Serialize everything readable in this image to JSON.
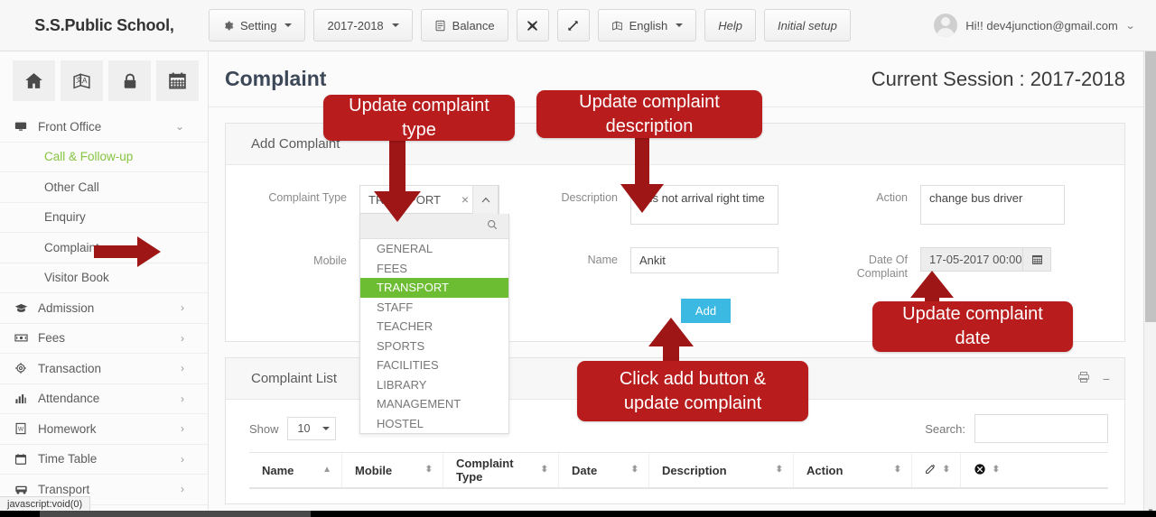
{
  "header": {
    "brand": "S.S.Public School,",
    "buttons": [
      {
        "label": "Setting",
        "icon": "gear-icon",
        "caret": true
      },
      {
        "label": "2017-2018",
        "icon": null,
        "caret": true
      },
      {
        "label": "Balance",
        "icon": "database-icon",
        "caret": false
      },
      {
        "label": "",
        "icon": "collapse-icon",
        "caret": false
      },
      {
        "label": "",
        "icon": "expand-icon",
        "caret": false
      },
      {
        "label": "English",
        "icon": "language-icon",
        "caret": true
      },
      {
        "label": "Help",
        "icon": null,
        "caret": false
      },
      {
        "label": "Initial setup",
        "icon": null,
        "caret": false
      }
    ],
    "user": {
      "greeting": "Hi!! dev4junction@gmail.com",
      "avatar": "avatar-icon",
      "caret": "chevron-down-icon"
    }
  },
  "sidebar": {
    "quick_icons": [
      "home-icon",
      "translate-icon",
      "lock-icon",
      "calendar-icon"
    ],
    "groups": [
      {
        "label": "Front Office",
        "icon": "monitor-icon",
        "state": "expanded",
        "chevron": "chevron-down-icon",
        "children": [
          {
            "label": "Call & Follow-up",
            "active": true
          },
          {
            "label": "Other Call",
            "active": false
          },
          {
            "label": "Enquiry",
            "active": false
          },
          {
            "label": "Complaint",
            "active": false
          },
          {
            "label": "Visitor Book",
            "active": false
          }
        ]
      },
      {
        "label": "Admission",
        "icon": "graduation-cap-icon",
        "state": "collapsed",
        "chevron": "chevron-right-icon",
        "children": []
      },
      {
        "label": "Fees",
        "icon": "money-icon",
        "state": "collapsed",
        "chevron": "chevron-right-icon",
        "children": []
      },
      {
        "label": "Transaction",
        "icon": "gear-icon",
        "state": "collapsed",
        "chevron": "chevron-right-icon",
        "children": []
      },
      {
        "label": "Attendance",
        "icon": "bar-chart-icon",
        "state": "collapsed",
        "chevron": "chevron-right-icon",
        "children": []
      },
      {
        "label": "Homework",
        "icon": "document-icon",
        "state": "collapsed",
        "chevron": "chevron-right-icon",
        "children": []
      },
      {
        "label": "Time Table",
        "icon": "calendar-icon",
        "state": "collapsed",
        "chevron": "chevron-right-icon",
        "children": []
      },
      {
        "label": "Transport",
        "icon": "bus-icon",
        "state": "collapsed",
        "chevron": "chevron-right-icon",
        "children": []
      }
    ]
  },
  "page": {
    "title": "Complaint",
    "session": "Current Session : 2017-2018"
  },
  "add_panel": {
    "title": "Add Complaint",
    "fields": {
      "complaint_type_label": "Complaint Type",
      "complaint_type_value": "TRANSPORT",
      "complaint_type_clear": "×",
      "complaint_type_caret": "chevron-up-icon",
      "mobile_label": "Mobile",
      "description_label": "Description",
      "description_value": "bus not arrival right time",
      "name_label": "Name",
      "name_value": "Ankit",
      "action_label": "Action",
      "action_value": "change bus driver",
      "date_label": "Date Of Complaint",
      "date_value": "17-05-2017 00:00",
      "date_icon": "calendar-icon"
    },
    "dropdown": {
      "open": true,
      "search_icon": "search-icon",
      "search_value": "",
      "options": [
        "GENERAL",
        "FEES",
        "TRANSPORT",
        "STAFF",
        "TEACHER",
        "SPORTS",
        "FACILITIES",
        "LIBRARY",
        "MANAGEMENT",
        "HOSTEL"
      ],
      "selected": "TRANSPORT",
      "selected_color": "#6dbd33"
    },
    "add_button": "Add"
  },
  "list_panel": {
    "title": "Complaint List",
    "tools": [
      "print-icon",
      "minimize-icon"
    ],
    "show_label": "Show",
    "show_value": "10",
    "search_label": "Search:",
    "search_value": "",
    "columns": [
      {
        "label": "Name",
        "sort": "asc",
        "width": 103
      },
      {
        "label": "Mobile",
        "sort": "both",
        "width": 112
      },
      {
        "label": "Complaint Type",
        "sort": "both",
        "width": 128
      },
      {
        "label": "Date",
        "sort": "both",
        "width": 100
      },
      {
        "label": "Description",
        "sort": "both",
        "width": 160
      },
      {
        "label": "Action",
        "sort": "both",
        "width": 131
      },
      {
        "label": "edit-icon",
        "sort": "both",
        "width": 54,
        "is_icon": true
      },
      {
        "label": "delete-icon",
        "sort": "both",
        "width": 54,
        "is_icon": true
      }
    ],
    "rows": []
  },
  "annotations": [
    {
      "id": "anno-type",
      "text": "Update complaint type"
    },
    {
      "id": "anno-description",
      "text": "Update complaint description"
    },
    {
      "id": "anno-date",
      "text": "Update complaint date"
    },
    {
      "id": "anno-add",
      "text": "Click add button & update complaint"
    }
  ],
  "status_bar": {
    "text": "javascript:void(0)"
  },
  "colors": {
    "annotation_red": "#b81c1c",
    "arrow_red": "#9e1616",
    "add_button_blue": "#3cb9e3",
    "selected_green": "#6dbd33",
    "active_link_green": "#86c440"
  }
}
